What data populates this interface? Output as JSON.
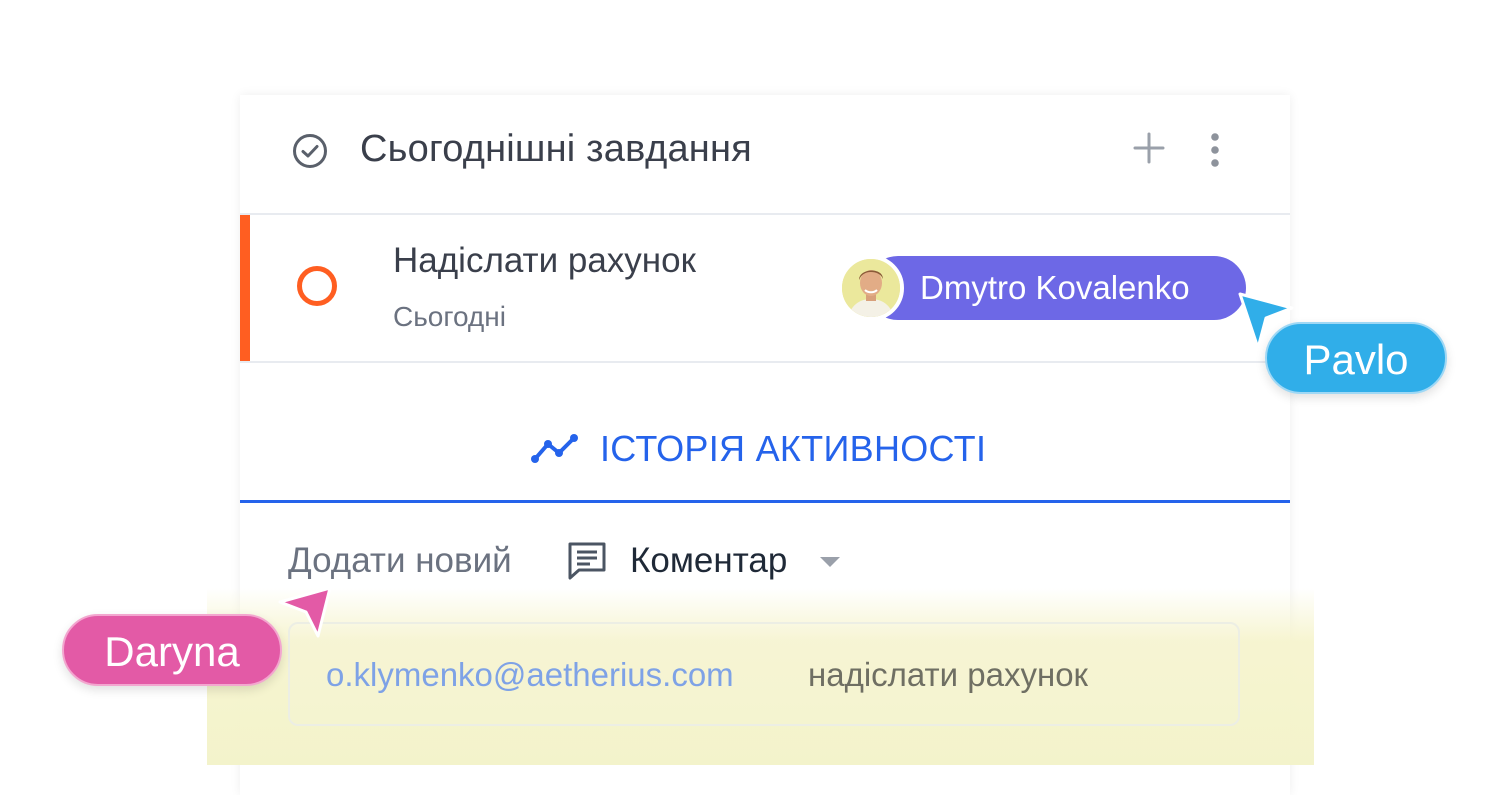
{
  "section": {
    "title": "Сьогоднішні завдання",
    "icons": {
      "check": "check-circle-icon",
      "add": "plus-icon",
      "menu": "more-vertical-icon"
    }
  },
  "task": {
    "title": "Надіслати рахунок",
    "due": "Сьогодні",
    "accent_color": "#ff5e21",
    "assignee": {
      "name": "Dmytro Kovalenko",
      "pill_color": "#6d68e6"
    }
  },
  "activity": {
    "tab_label": "ІСТОРІЯ АКТИВНОСТІ",
    "accent_color": "#2563eb",
    "add_label": "Додати новий",
    "type_selected": "Коментар"
  },
  "comment": {
    "mention": "o.klymenko@aetherius.com",
    "text": "надіслати рахунок"
  },
  "cursors": [
    {
      "name": "Pavlo",
      "color": "#30aee9"
    },
    {
      "name": "Daryna",
      "color": "#e35aa6"
    }
  ]
}
